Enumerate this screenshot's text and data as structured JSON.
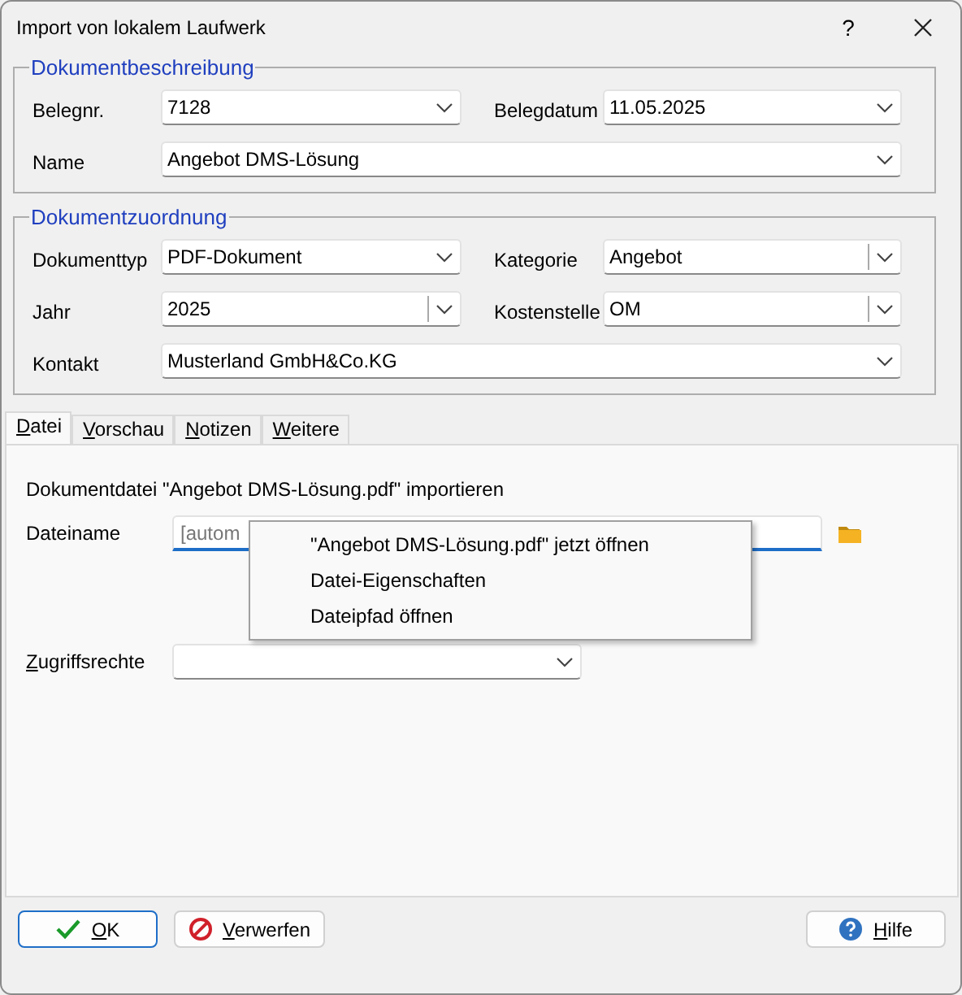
{
  "window": {
    "title": "Import von lokalem Laufwerk",
    "help_button": "?"
  },
  "dokumentbeschreibung": {
    "title": "Dokumentbeschreibung",
    "fields": [
      {
        "label": "Belegnr.",
        "value": "7128",
        "kind": "plain"
      },
      {
        "label": "Belegdatum",
        "value": "11.05.2025",
        "kind": "plain"
      },
      {
        "label": "Name",
        "value": "Angebot DMS-Lösung",
        "kind": "plain"
      }
    ]
  },
  "dokumentzuordnung": {
    "title": "Dokumentzuordnung",
    "fields": [
      {
        "label": "Dokumenttyp",
        "value": "PDF-Dokument",
        "kind": "plain"
      },
      {
        "label": "Kategorie",
        "value": "Angebot",
        "kind": "split"
      },
      {
        "label": "Jahr",
        "value": "2025",
        "kind": "split"
      },
      {
        "label": "Kostenstelle",
        "value": "OM",
        "kind": "split"
      },
      {
        "label": "Kontakt",
        "value": "Musterland GmbH&Co.KG",
        "kind": "plain"
      }
    ]
  },
  "tabs": [
    {
      "label": "Datei",
      "selected": true
    },
    {
      "label": "Vorschau",
      "selected": false
    },
    {
      "label": "Notizen",
      "selected": false
    },
    {
      "label": "Weitere",
      "selected": false
    }
  ],
  "datei": {
    "import_text": "Dokumentdatei \"Angebot DMS-Lösung.pdf\" importieren",
    "dateiname": {
      "label": "Dateiname",
      "placeholder": "[autom",
      "focused": true
    },
    "zugriffsrechte": {
      "label": "Zugriffsrechte"
    }
  },
  "context_menu": {
    "items": [
      "\"Angebot DMS-Lösung.pdf\" jetzt öffnen",
      "Datei-Eigenschaften",
      "Dateipfad öffnen"
    ]
  },
  "buttons": [
    {
      "label": "OK",
      "kind": "check",
      "default": true
    },
    {
      "label": "Verwerfen",
      "kind": "cancel",
      "default": false
    }
  ],
  "help_button": {
    "label": "Hilfe",
    "kind": "help",
    "default": false
  }
}
